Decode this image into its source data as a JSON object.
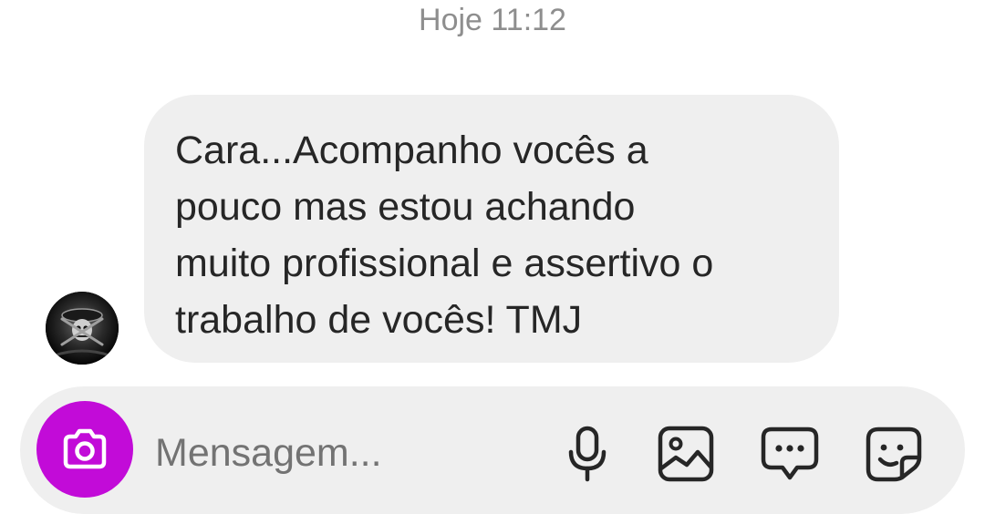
{
  "chat": {
    "timestamp": "Hoje 11:12",
    "messages": [
      {
        "sender": "contact",
        "text": "Cara...Acompanho vocês a\npouco mas estou achando\nmuito profissional e assertivo o\ntrabalho de vocês! TMJ"
      }
    ]
  },
  "composer": {
    "placeholder": "Mensagem...",
    "value": "",
    "camera_icon": "camera-icon",
    "tools": [
      "microphone-icon",
      "gallery-icon",
      "chat-bubble-icon",
      "sticker-icon"
    ]
  },
  "colors": {
    "camera_button": "#c20bd8",
    "bubble": "#efefef",
    "composer": "#efefef",
    "timestamp": "#8e8e8e",
    "text": "#262626"
  }
}
